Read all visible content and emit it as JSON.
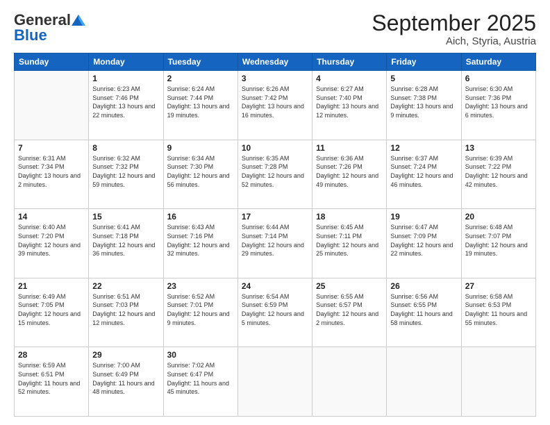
{
  "header": {
    "logo_general": "General",
    "logo_blue": "Blue",
    "title": "September 2025",
    "subtitle": "Aich, Styria, Austria"
  },
  "days_of_week": [
    "Sunday",
    "Monday",
    "Tuesday",
    "Wednesday",
    "Thursday",
    "Friday",
    "Saturday"
  ],
  "weeks": [
    [
      {
        "day": "",
        "sunrise": "",
        "sunset": "",
        "daylight": ""
      },
      {
        "day": "1",
        "sunrise": "Sunrise: 6:23 AM",
        "sunset": "Sunset: 7:46 PM",
        "daylight": "Daylight: 13 hours and 22 minutes."
      },
      {
        "day": "2",
        "sunrise": "Sunrise: 6:24 AM",
        "sunset": "Sunset: 7:44 PM",
        "daylight": "Daylight: 13 hours and 19 minutes."
      },
      {
        "day": "3",
        "sunrise": "Sunrise: 6:26 AM",
        "sunset": "Sunset: 7:42 PM",
        "daylight": "Daylight: 13 hours and 16 minutes."
      },
      {
        "day": "4",
        "sunrise": "Sunrise: 6:27 AM",
        "sunset": "Sunset: 7:40 PM",
        "daylight": "Daylight: 13 hours and 12 minutes."
      },
      {
        "day": "5",
        "sunrise": "Sunrise: 6:28 AM",
        "sunset": "Sunset: 7:38 PM",
        "daylight": "Daylight: 13 hours and 9 minutes."
      },
      {
        "day": "6",
        "sunrise": "Sunrise: 6:30 AM",
        "sunset": "Sunset: 7:36 PM",
        "daylight": "Daylight: 13 hours and 6 minutes."
      }
    ],
    [
      {
        "day": "7",
        "sunrise": "Sunrise: 6:31 AM",
        "sunset": "Sunset: 7:34 PM",
        "daylight": "Daylight: 13 hours and 2 minutes."
      },
      {
        "day": "8",
        "sunrise": "Sunrise: 6:32 AM",
        "sunset": "Sunset: 7:32 PM",
        "daylight": "Daylight: 12 hours and 59 minutes."
      },
      {
        "day": "9",
        "sunrise": "Sunrise: 6:34 AM",
        "sunset": "Sunset: 7:30 PM",
        "daylight": "Daylight: 12 hours and 56 minutes."
      },
      {
        "day": "10",
        "sunrise": "Sunrise: 6:35 AM",
        "sunset": "Sunset: 7:28 PM",
        "daylight": "Daylight: 12 hours and 52 minutes."
      },
      {
        "day": "11",
        "sunrise": "Sunrise: 6:36 AM",
        "sunset": "Sunset: 7:26 PM",
        "daylight": "Daylight: 12 hours and 49 minutes."
      },
      {
        "day": "12",
        "sunrise": "Sunrise: 6:37 AM",
        "sunset": "Sunset: 7:24 PM",
        "daylight": "Daylight: 12 hours and 46 minutes."
      },
      {
        "day": "13",
        "sunrise": "Sunrise: 6:39 AM",
        "sunset": "Sunset: 7:22 PM",
        "daylight": "Daylight: 12 hours and 42 minutes."
      }
    ],
    [
      {
        "day": "14",
        "sunrise": "Sunrise: 6:40 AM",
        "sunset": "Sunset: 7:20 PM",
        "daylight": "Daylight: 12 hours and 39 minutes."
      },
      {
        "day": "15",
        "sunrise": "Sunrise: 6:41 AM",
        "sunset": "Sunset: 7:18 PM",
        "daylight": "Daylight: 12 hours and 36 minutes."
      },
      {
        "day": "16",
        "sunrise": "Sunrise: 6:43 AM",
        "sunset": "Sunset: 7:16 PM",
        "daylight": "Daylight: 12 hours and 32 minutes."
      },
      {
        "day": "17",
        "sunrise": "Sunrise: 6:44 AM",
        "sunset": "Sunset: 7:14 PM",
        "daylight": "Daylight: 12 hours and 29 minutes."
      },
      {
        "day": "18",
        "sunrise": "Sunrise: 6:45 AM",
        "sunset": "Sunset: 7:11 PM",
        "daylight": "Daylight: 12 hours and 25 minutes."
      },
      {
        "day": "19",
        "sunrise": "Sunrise: 6:47 AM",
        "sunset": "Sunset: 7:09 PM",
        "daylight": "Daylight: 12 hours and 22 minutes."
      },
      {
        "day": "20",
        "sunrise": "Sunrise: 6:48 AM",
        "sunset": "Sunset: 7:07 PM",
        "daylight": "Daylight: 12 hours and 19 minutes."
      }
    ],
    [
      {
        "day": "21",
        "sunrise": "Sunrise: 6:49 AM",
        "sunset": "Sunset: 7:05 PM",
        "daylight": "Daylight: 12 hours and 15 minutes."
      },
      {
        "day": "22",
        "sunrise": "Sunrise: 6:51 AM",
        "sunset": "Sunset: 7:03 PM",
        "daylight": "Daylight: 12 hours and 12 minutes."
      },
      {
        "day": "23",
        "sunrise": "Sunrise: 6:52 AM",
        "sunset": "Sunset: 7:01 PM",
        "daylight": "Daylight: 12 hours and 9 minutes."
      },
      {
        "day": "24",
        "sunrise": "Sunrise: 6:54 AM",
        "sunset": "Sunset: 6:59 PM",
        "daylight": "Daylight: 12 hours and 5 minutes."
      },
      {
        "day": "25",
        "sunrise": "Sunrise: 6:55 AM",
        "sunset": "Sunset: 6:57 PM",
        "daylight": "Daylight: 12 hours and 2 minutes."
      },
      {
        "day": "26",
        "sunrise": "Sunrise: 6:56 AM",
        "sunset": "Sunset: 6:55 PM",
        "daylight": "Daylight: 11 hours and 58 minutes."
      },
      {
        "day": "27",
        "sunrise": "Sunrise: 6:58 AM",
        "sunset": "Sunset: 6:53 PM",
        "daylight": "Daylight: 11 hours and 55 minutes."
      }
    ],
    [
      {
        "day": "28",
        "sunrise": "Sunrise: 6:59 AM",
        "sunset": "Sunset: 6:51 PM",
        "daylight": "Daylight: 11 hours and 52 minutes."
      },
      {
        "day": "29",
        "sunrise": "Sunrise: 7:00 AM",
        "sunset": "Sunset: 6:49 PM",
        "daylight": "Daylight: 11 hours and 48 minutes."
      },
      {
        "day": "30",
        "sunrise": "Sunrise: 7:02 AM",
        "sunset": "Sunset: 6:47 PM",
        "daylight": "Daylight: 11 hours and 45 minutes."
      },
      {
        "day": "",
        "sunrise": "",
        "sunset": "",
        "daylight": ""
      },
      {
        "day": "",
        "sunrise": "",
        "sunset": "",
        "daylight": ""
      },
      {
        "day": "",
        "sunrise": "",
        "sunset": "",
        "daylight": ""
      },
      {
        "day": "",
        "sunrise": "",
        "sunset": "",
        "daylight": ""
      }
    ]
  ]
}
